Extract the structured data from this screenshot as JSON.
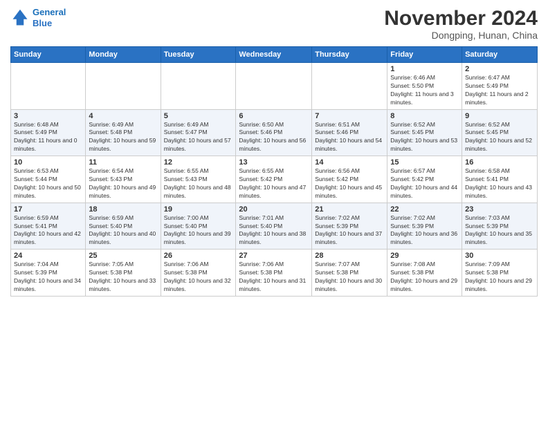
{
  "header": {
    "logo_line1": "General",
    "logo_line2": "Blue",
    "month_title": "November 2024",
    "location": "Dongping, Hunan, China"
  },
  "weekdays": [
    "Sunday",
    "Monday",
    "Tuesday",
    "Wednesday",
    "Thursday",
    "Friday",
    "Saturday"
  ],
  "rows": [
    [
      {
        "day": "",
        "info": ""
      },
      {
        "day": "",
        "info": ""
      },
      {
        "day": "",
        "info": ""
      },
      {
        "day": "",
        "info": ""
      },
      {
        "day": "",
        "info": ""
      },
      {
        "day": "1",
        "info": "Sunrise: 6:46 AM\nSunset: 5:50 PM\nDaylight: 11 hours and 3 minutes."
      },
      {
        "day": "2",
        "info": "Sunrise: 6:47 AM\nSunset: 5:49 PM\nDaylight: 11 hours and 2 minutes."
      }
    ],
    [
      {
        "day": "3",
        "info": "Sunrise: 6:48 AM\nSunset: 5:49 PM\nDaylight: 11 hours and 0 minutes."
      },
      {
        "day": "4",
        "info": "Sunrise: 6:49 AM\nSunset: 5:48 PM\nDaylight: 10 hours and 59 minutes."
      },
      {
        "day": "5",
        "info": "Sunrise: 6:49 AM\nSunset: 5:47 PM\nDaylight: 10 hours and 57 minutes."
      },
      {
        "day": "6",
        "info": "Sunrise: 6:50 AM\nSunset: 5:46 PM\nDaylight: 10 hours and 56 minutes."
      },
      {
        "day": "7",
        "info": "Sunrise: 6:51 AM\nSunset: 5:46 PM\nDaylight: 10 hours and 54 minutes."
      },
      {
        "day": "8",
        "info": "Sunrise: 6:52 AM\nSunset: 5:45 PM\nDaylight: 10 hours and 53 minutes."
      },
      {
        "day": "9",
        "info": "Sunrise: 6:52 AM\nSunset: 5:45 PM\nDaylight: 10 hours and 52 minutes."
      }
    ],
    [
      {
        "day": "10",
        "info": "Sunrise: 6:53 AM\nSunset: 5:44 PM\nDaylight: 10 hours and 50 minutes."
      },
      {
        "day": "11",
        "info": "Sunrise: 6:54 AM\nSunset: 5:43 PM\nDaylight: 10 hours and 49 minutes."
      },
      {
        "day": "12",
        "info": "Sunrise: 6:55 AM\nSunset: 5:43 PM\nDaylight: 10 hours and 48 minutes."
      },
      {
        "day": "13",
        "info": "Sunrise: 6:55 AM\nSunset: 5:42 PM\nDaylight: 10 hours and 47 minutes."
      },
      {
        "day": "14",
        "info": "Sunrise: 6:56 AM\nSunset: 5:42 PM\nDaylight: 10 hours and 45 minutes."
      },
      {
        "day": "15",
        "info": "Sunrise: 6:57 AM\nSunset: 5:42 PM\nDaylight: 10 hours and 44 minutes."
      },
      {
        "day": "16",
        "info": "Sunrise: 6:58 AM\nSunset: 5:41 PM\nDaylight: 10 hours and 43 minutes."
      }
    ],
    [
      {
        "day": "17",
        "info": "Sunrise: 6:59 AM\nSunset: 5:41 PM\nDaylight: 10 hours and 42 minutes."
      },
      {
        "day": "18",
        "info": "Sunrise: 6:59 AM\nSunset: 5:40 PM\nDaylight: 10 hours and 40 minutes."
      },
      {
        "day": "19",
        "info": "Sunrise: 7:00 AM\nSunset: 5:40 PM\nDaylight: 10 hours and 39 minutes."
      },
      {
        "day": "20",
        "info": "Sunrise: 7:01 AM\nSunset: 5:40 PM\nDaylight: 10 hours and 38 minutes."
      },
      {
        "day": "21",
        "info": "Sunrise: 7:02 AM\nSunset: 5:39 PM\nDaylight: 10 hours and 37 minutes."
      },
      {
        "day": "22",
        "info": "Sunrise: 7:02 AM\nSunset: 5:39 PM\nDaylight: 10 hours and 36 minutes."
      },
      {
        "day": "23",
        "info": "Sunrise: 7:03 AM\nSunset: 5:39 PM\nDaylight: 10 hours and 35 minutes."
      }
    ],
    [
      {
        "day": "24",
        "info": "Sunrise: 7:04 AM\nSunset: 5:39 PM\nDaylight: 10 hours and 34 minutes."
      },
      {
        "day": "25",
        "info": "Sunrise: 7:05 AM\nSunset: 5:38 PM\nDaylight: 10 hours and 33 minutes."
      },
      {
        "day": "26",
        "info": "Sunrise: 7:06 AM\nSunset: 5:38 PM\nDaylight: 10 hours and 32 minutes."
      },
      {
        "day": "27",
        "info": "Sunrise: 7:06 AM\nSunset: 5:38 PM\nDaylight: 10 hours and 31 minutes."
      },
      {
        "day": "28",
        "info": "Sunrise: 7:07 AM\nSunset: 5:38 PM\nDaylight: 10 hours and 30 minutes."
      },
      {
        "day": "29",
        "info": "Sunrise: 7:08 AM\nSunset: 5:38 PM\nDaylight: 10 hours and 29 minutes."
      },
      {
        "day": "30",
        "info": "Sunrise: 7:09 AM\nSunset: 5:38 PM\nDaylight: 10 hours and 29 minutes."
      }
    ]
  ]
}
